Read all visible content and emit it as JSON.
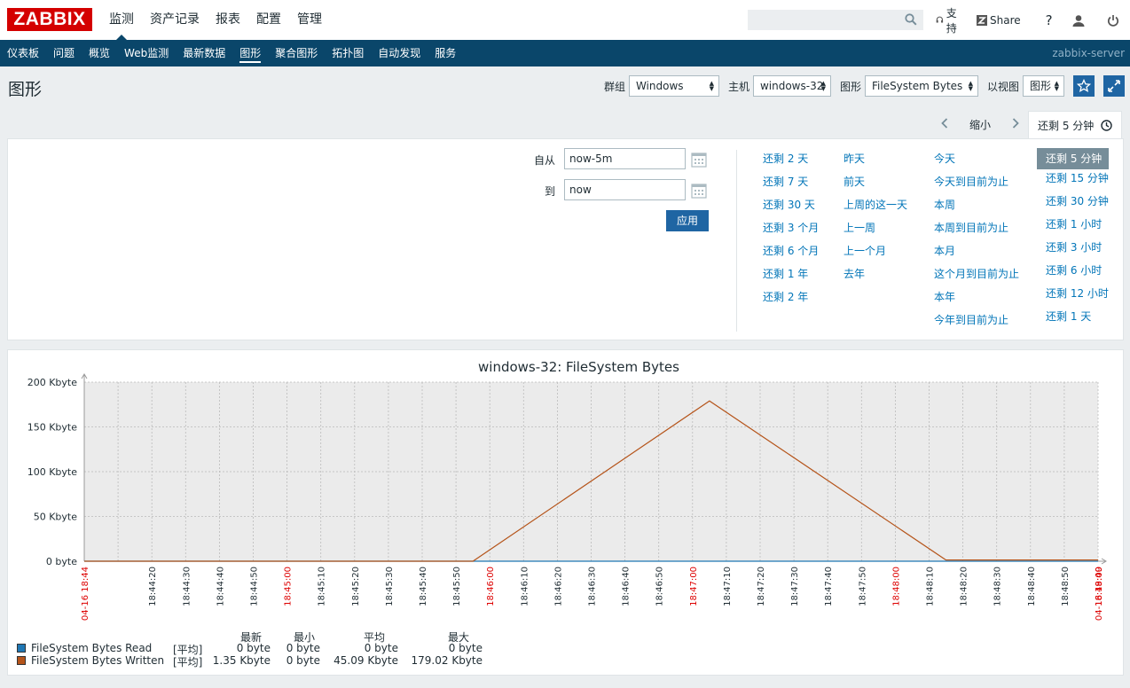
{
  "topbar": {
    "logo": "ZABBIX",
    "menu": [
      "监测",
      "资产记录",
      "报表",
      "配置",
      "管理"
    ],
    "support_label": "支持",
    "share_label": "Share",
    "help_label": "?"
  },
  "nav2": {
    "items": [
      "仪表板",
      "问题",
      "概览",
      "Web监测",
      "最新数据",
      "图形",
      "聚合图形",
      "拓扑图",
      "自动发现",
      "服务"
    ],
    "active": "图形",
    "server": "zabbix-server"
  },
  "header": {
    "title": "图形",
    "group_label": "群组",
    "group_value": "Windows",
    "host_label": "主机",
    "host_value": "windows-32",
    "graph_label": "图形",
    "graph_value": "FileSystem Bytes",
    "view_label": "以视图",
    "view_value": "图形"
  },
  "timebar": {
    "zoom_out": "缩小",
    "active_tab": "还剩 5 分钟"
  },
  "filter": {
    "from_label": "自从",
    "from_value": "now-5m",
    "to_label": "到",
    "to_value": "now",
    "apply_label": "应用",
    "quick_cols": [
      [
        "还剩 2 天",
        "还剩 7 天",
        "还剩 30 天",
        "还剩 3 个月",
        "还剩 6 个月",
        "还剩 1 年",
        "还剩 2 年"
      ],
      [
        "昨天",
        "前天",
        "上周的这一天",
        "上一周",
        "上一个月",
        "去年"
      ],
      [
        "今天",
        "今天到目前为止",
        "本周",
        "本周到目前为止",
        "本月",
        "这个月到目前为止",
        "本年",
        "今年到目前为止"
      ],
      [
        "还剩 5 分钟",
        "还剩 15 分钟",
        "还剩 30 分钟",
        "还剩 1 小时",
        "还剩 3 小时",
        "还剩 6 小时",
        "还剩 12 小时",
        "还剩 1 天"
      ]
    ],
    "selected": "还剩 5 分钟"
  },
  "chart_data": {
    "type": "line",
    "title": "windows-32: FileSystem Bytes",
    "ylim": [
      0,
      200
    ],
    "yticks": [
      "0 byte",
      "50 Kbyte",
      "100 Kbyte",
      "150 Kbyte",
      "200 Kbyte"
    ],
    "x_minutes": [
      "18:45:00",
      "18:46:00",
      "18:47:00",
      "18:48:00",
      "18:49:00"
    ],
    "x_ticks": [
      "18:44:20",
      "18:44:30",
      "18:44:40",
      "18:44:50",
      "18:45:10",
      "18:45:20",
      "18:45:30",
      "18:45:40",
      "18:45:50",
      "18:46:10",
      "18:46:20",
      "18:46:30",
      "18:46:40",
      "18:46:50",
      "18:47:10",
      "18:47:20",
      "18:47:30",
      "18:47:40",
      "18:47:50",
      "18:48:10",
      "18:48:20",
      "18:48:30",
      "18:48:40",
      "18:48:50"
    ],
    "x_start": "04-16 18:44",
    "x_end": "04-16 18:49",
    "series": [
      {
        "name": "FileSystem Bytes Read",
        "color": "#1f77b4",
        "points": [
          [
            "18:44:00",
            0
          ],
          [
            "18:49:00",
            0
          ]
        ]
      },
      {
        "name": "FileSystem Bytes Written",
        "color": "#b5541a",
        "points": [
          [
            "18:44:00",
            0
          ],
          [
            "18:45:55",
            0
          ],
          [
            "18:47:05",
            179.02
          ],
          [
            "18:48:15",
            1.35
          ],
          [
            "18:49:00",
            1.35
          ]
        ]
      }
    ],
    "legend_headers": [
      "最新",
      "最小",
      "平均",
      "最大"
    ],
    "legend_rows": [
      {
        "name": "FileSystem Bytes Read",
        "func": "[平均]",
        "last": "0 byte",
        "min": "0 byte",
        "avg": "0 byte",
        "max": "0 byte"
      },
      {
        "name": "FileSystem Bytes Written",
        "func": "[平均]",
        "last": "1.35 Kbyte",
        "min": "0 byte",
        "avg": "45.09 Kbyte",
        "max": "179.02 Kbyte"
      }
    ]
  }
}
